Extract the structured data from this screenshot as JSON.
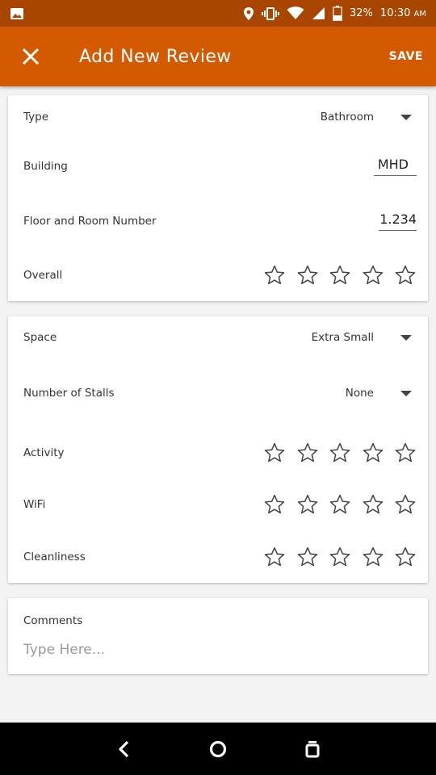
{
  "status_bar": {
    "battery": "32%",
    "time": "10:30",
    "ampm": "AM"
  },
  "app_bar": {
    "title": "Add New Review",
    "save_label": "SAVE",
    "close_icon": "close-icon"
  },
  "card1": {
    "type_label": "Type",
    "type_value": "Bathroom",
    "building_label": "Building",
    "building_value": "MHD",
    "room_label": "Floor and Room Number",
    "room_value": "1.234",
    "overall_label": "Overall",
    "overall_rating": 0
  },
  "card2": {
    "space_label": "Space",
    "space_value": "Extra Small",
    "stalls_label": "Number of Stalls",
    "stalls_value": "None",
    "activity_label": "Activity",
    "activity_rating": 0,
    "wifi_label": "WiFi",
    "wifi_rating": 0,
    "cleanliness_label": "Cleanliness",
    "cleanliness_rating": 0
  },
  "card3": {
    "comments_label": "Comments",
    "comments_placeholder": "Type Here..."
  },
  "colors": {
    "status_bar": "#a84600",
    "app_bar": "#d35a00",
    "background": "#f3f3f3"
  }
}
